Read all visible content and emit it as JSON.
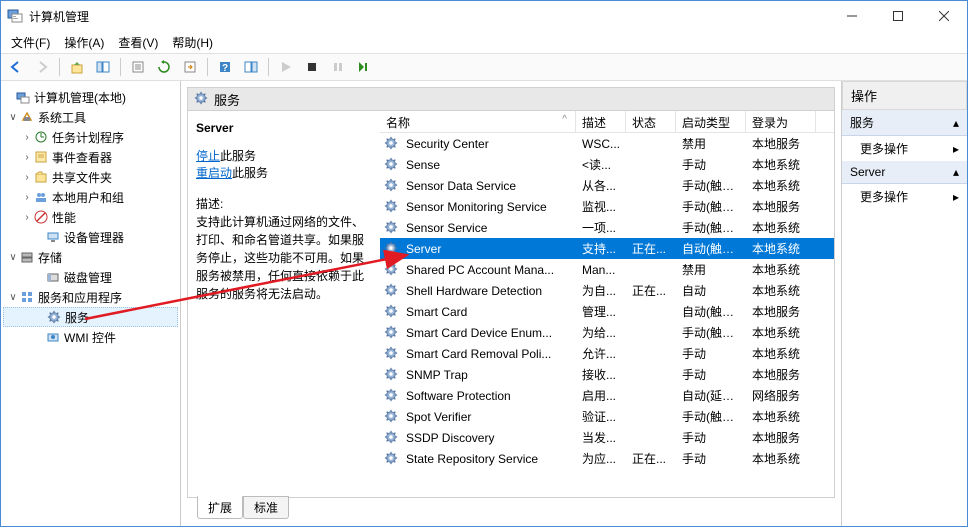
{
  "window": {
    "title": "计算机管理"
  },
  "menu": {
    "file": "文件(F)",
    "action": "操作(A)",
    "view": "查看(V)",
    "help": "帮助(H)"
  },
  "tree": {
    "root": "计算机管理(本地)",
    "systools": "系统工具",
    "sched": "任务计划程序",
    "eventvwr": "事件查看器",
    "sharedfolders": "共享文件夹",
    "localusers": "本地用户和组",
    "perf": "性能",
    "devmgr": "设备管理器",
    "storage": "存储",
    "diskmgmt": "磁盘管理",
    "svcapps": "服务和应用程序",
    "services": "服务",
    "wmi": "WMI 控件"
  },
  "panel": {
    "heading": "服务",
    "selected_name": "Server",
    "stop_label": "停止",
    "stop_suffix": "此服务",
    "restart_label": "重启动",
    "restart_suffix": "此服务",
    "desc_label": "描述:",
    "desc_text": "支持此计算机通过网络的文件、打印、和命名管道共享。如果服务停止，这些功能不可用。如果服务被禁用，任何直接依赖于此服务的服务将无法启动。"
  },
  "columns": {
    "name": "名称",
    "desc": "描述",
    "status": "状态",
    "startup": "启动类型",
    "logon": "登录为"
  },
  "services": [
    {
      "name": "Security Center",
      "desc": "WSC...",
      "status": "",
      "startup": "禁用",
      "logon": "本地服务"
    },
    {
      "name": "Sense",
      "desc": "<读...",
      "status": "",
      "startup": "手动",
      "logon": "本地系统"
    },
    {
      "name": "Sensor Data Service",
      "desc": "从各...",
      "status": "",
      "startup": "手动(触发...",
      "logon": "本地系统"
    },
    {
      "name": "Sensor Monitoring Service",
      "desc": "监视...",
      "status": "",
      "startup": "手动(触发...",
      "logon": "本地服务"
    },
    {
      "name": "Sensor Service",
      "desc": "一项...",
      "status": "",
      "startup": "手动(触发...",
      "logon": "本地系统"
    },
    {
      "name": "Server",
      "desc": "支持...",
      "status": "正在...",
      "startup": "自动(触发...",
      "logon": "本地系统",
      "selected": true
    },
    {
      "name": "Shared PC Account Mana...",
      "desc": "Man...",
      "status": "",
      "startup": "禁用",
      "logon": "本地系统"
    },
    {
      "name": "Shell Hardware Detection",
      "desc": "为自...",
      "status": "正在...",
      "startup": "自动",
      "logon": "本地系统"
    },
    {
      "name": "Smart Card",
      "desc": "管理...",
      "status": "",
      "startup": "自动(触发...",
      "logon": "本地服务"
    },
    {
      "name": "Smart Card Device Enum...",
      "desc": "为给...",
      "status": "",
      "startup": "手动(触发...",
      "logon": "本地系统"
    },
    {
      "name": "Smart Card Removal Poli...",
      "desc": "允许...",
      "status": "",
      "startup": "手动",
      "logon": "本地系统"
    },
    {
      "name": "SNMP Trap",
      "desc": "接收...",
      "status": "",
      "startup": "手动",
      "logon": "本地服务"
    },
    {
      "name": "Software Protection",
      "desc": "启用...",
      "status": "",
      "startup": "自动(延迟...",
      "logon": "网络服务"
    },
    {
      "name": "Spot Verifier",
      "desc": "验证...",
      "status": "",
      "startup": "手动(触发...",
      "logon": "本地系统"
    },
    {
      "name": "SSDP Discovery",
      "desc": "当发...",
      "status": "",
      "startup": "手动",
      "logon": "本地服务"
    },
    {
      "name": "State Repository Service",
      "desc": "为应...",
      "status": "正在...",
      "startup": "手动",
      "logon": "本地系统"
    }
  ],
  "tabs": {
    "extended": "扩展",
    "standard": "标准"
  },
  "actions": {
    "header": "操作",
    "svc_group": "服务",
    "server_group": "Server",
    "more": "更多操作"
  }
}
